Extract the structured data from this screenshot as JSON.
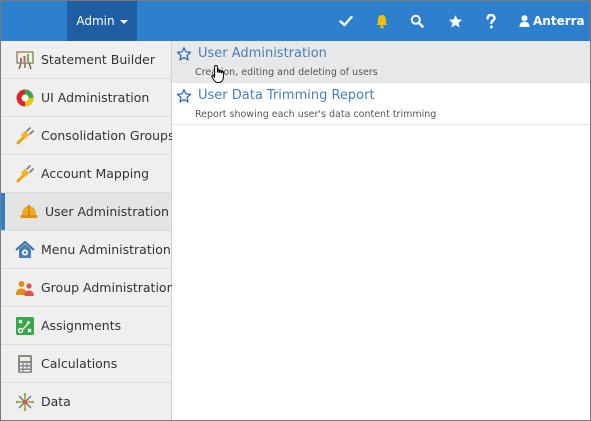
{
  "header": {
    "admin_menu_label": "Admin",
    "user_name": "Anterra U",
    "icons": [
      "check-icon",
      "bell-icon",
      "search-icon",
      "star-icon",
      "help-icon",
      "user-icon"
    ],
    "colors": {
      "bar": "#2e80cf",
      "active_menu": "#1f5ea3",
      "bell": "#f2c200"
    }
  },
  "sidebar": {
    "items": [
      {
        "label": "Statement Builder",
        "icon": "easel-chart-icon"
      },
      {
        "label": "UI Administration",
        "icon": "ui-palette-icon"
      },
      {
        "label": "Consolidation Groups",
        "icon": "plug-icon"
      },
      {
        "label": "Account Mapping",
        "icon": "plug-icon"
      },
      {
        "label": "User Administration",
        "icon": "hardhat-icon",
        "active": true
      },
      {
        "label": "Menu Administration",
        "icon": "house-gear-icon"
      },
      {
        "label": "Group Administration",
        "icon": "users-group-icon"
      },
      {
        "label": "Assignments",
        "icon": "tactics-board-icon"
      },
      {
        "label": "Calculations",
        "icon": "calculator-icon"
      },
      {
        "label": "Data",
        "icon": "data-sparkle-icon"
      }
    ]
  },
  "content": {
    "items": [
      {
        "title": "User Administration",
        "description": "Creation, editing and deleting of users"
      },
      {
        "title": "User Data Trimming Report",
        "description": "Report showing each user's data content trimming"
      }
    ]
  }
}
